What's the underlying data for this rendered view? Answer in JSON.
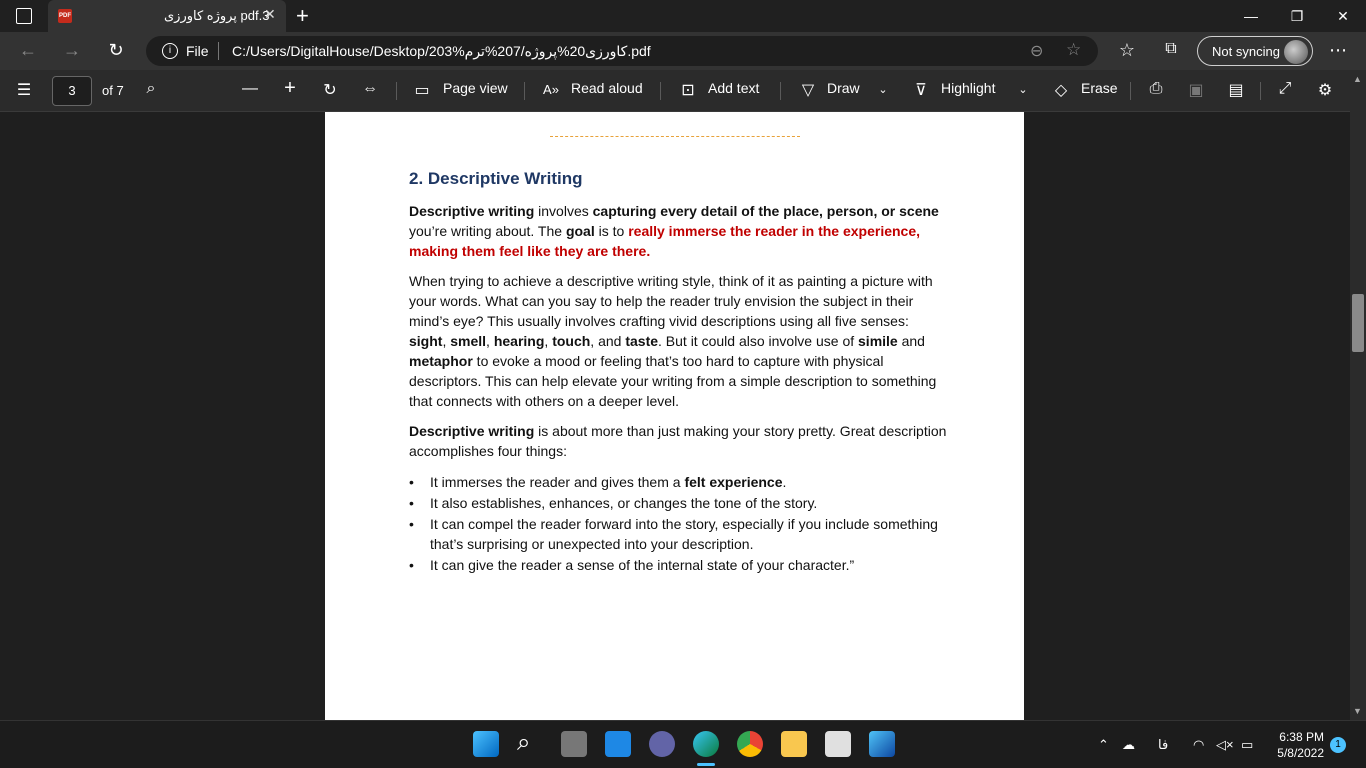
{
  "tab": {
    "title": "پروژه کاورزی pdf.3",
    "new_tab": "+"
  },
  "window": {
    "minimize": "—",
    "restore": "❐",
    "close": "✕"
  },
  "address": {
    "scheme_label": "File",
    "url": "C:/Users/DigitalHouse/Desktop/203%کاورزی20%پروژه/207%ترم.pdf",
    "sync_label": "Not syncing"
  },
  "pdf_toolbar": {
    "page_current": "3",
    "page_total": "of 7",
    "page_view": "Page view",
    "read_aloud": "Read aloud",
    "add_text": "Add text",
    "draw": "Draw",
    "highlight": "Highlight",
    "erase": "Erase"
  },
  "document": {
    "heading": "2. Descriptive Writing",
    "p1_part1": "Descriptive writing",
    "p1_part2": " involves ",
    "p1_part3": "capturing every detail of the place, person, or scene",
    "p1_part4": " you’re writing about. The ",
    "p1_part5": "goal",
    "p1_part6": " is to ",
    "p1_red": "really immerse the reader in the experience, making them feel like they are there.",
    "p2_part1": "When trying to achieve a descriptive writing style, think of it as painting a picture with your words. What can you say to help the reader truly envision the subject in their mind’s eye? This usually involves crafting vivid descriptions using all five senses: ",
    "sense_sight": "sight",
    "sense_smell": "smell",
    "sense_hearing": "hearing",
    "sense_touch": "touch",
    "sense_taste": "taste",
    "p2_part2": ". But it could also involve use of ",
    "simile": "simile",
    "and_word": " and ",
    "metaphor": "metaphor",
    "p2_part3": " to evoke a mood or feeling that’s too hard to capture with physical descriptors. This can help elevate your writing from a simple description to something that connects with others on a deeper level.",
    "p3_part1": "Descriptive writing",
    "p3_part2": " is about more than just making your story pretty. Great description accomplishes four things:",
    "bullet1_a": "It immerses the reader and gives them a ",
    "bullet1_b": "felt experience",
    "bullet1_c": ".",
    "bullet2": "It also establishes, enhances, or changes the tone of the story.",
    "bullet3": "It can compel the reader forward into the story, especially if you include something that’s surprising or unexpected into your description.",
    "bullet4": "It can give the reader a sense of the internal state of your character.”"
  },
  "taskbar": {
    "lang": "فا",
    "time": "6:38 PM",
    "date": "5/8/2022",
    "notifications": "1"
  }
}
